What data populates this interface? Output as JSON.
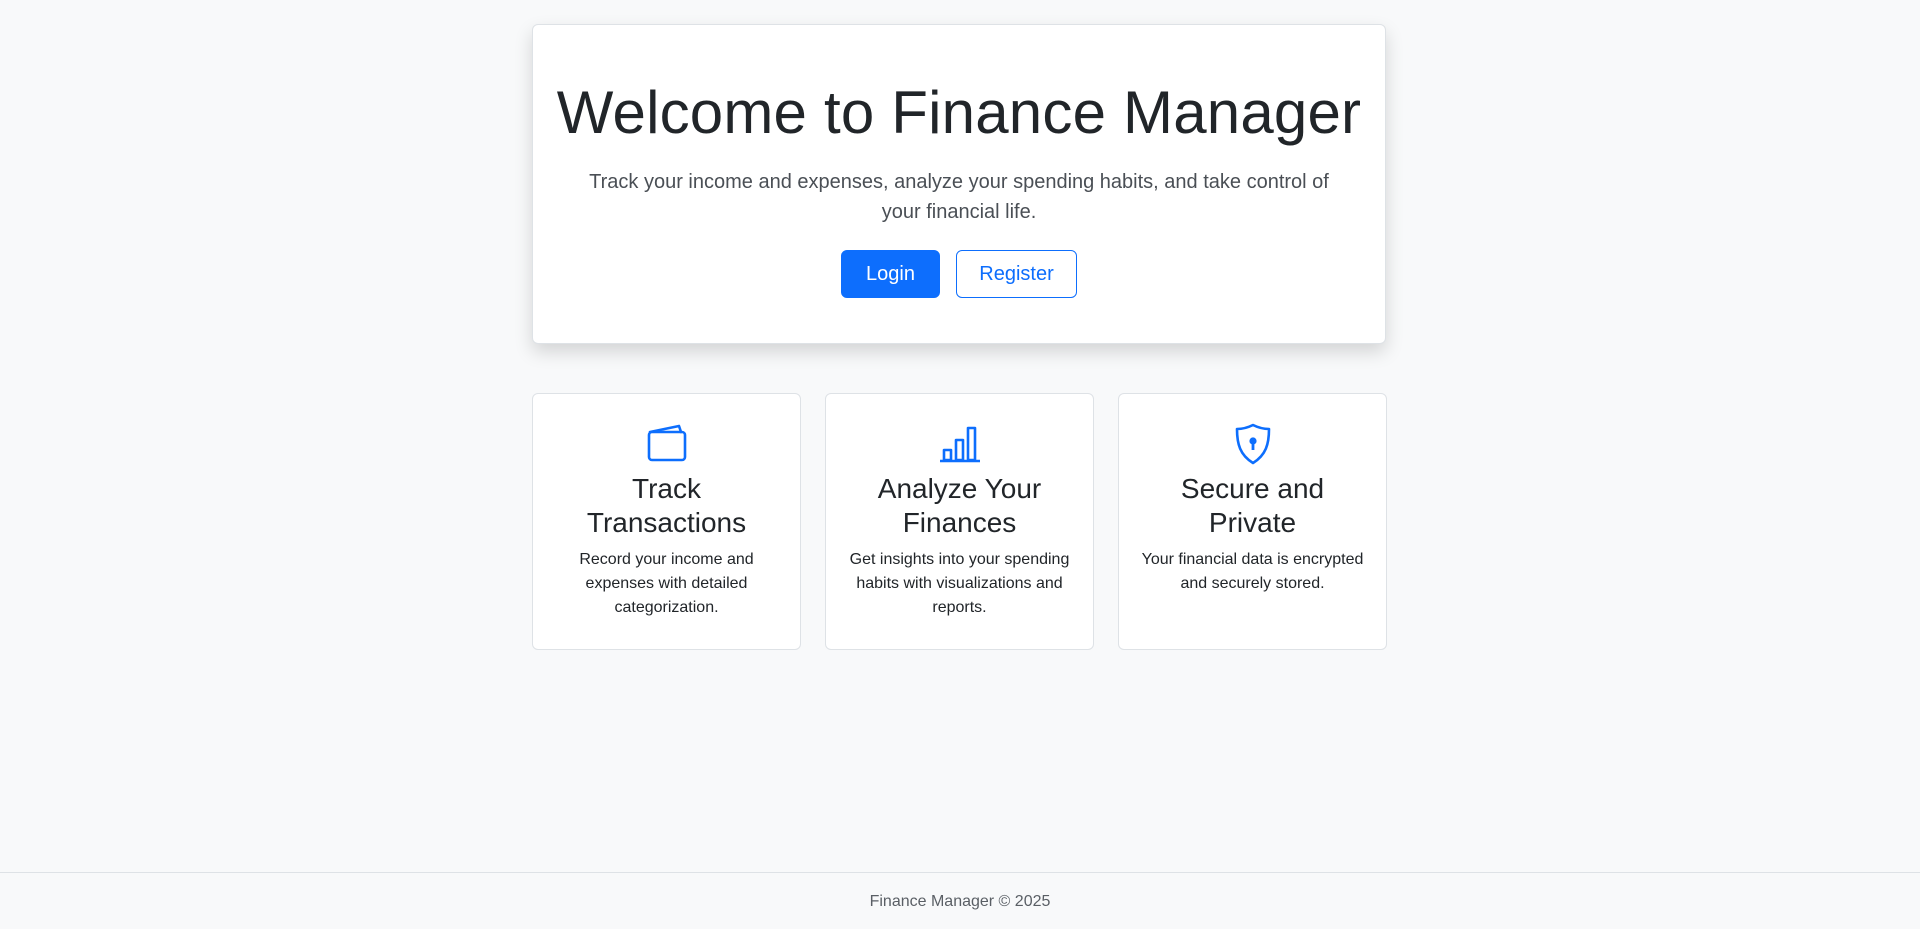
{
  "hero": {
    "title": "Welcome to Finance Manager",
    "lead": "Track your income and expenses, analyze your spending habits, and take control of your financial life.",
    "login_label": "Login",
    "register_label": "Register"
  },
  "features": [
    {
      "icon": "wallet-icon",
      "title": "Track Transactions",
      "description": "Record your income and expenses with detailed categorization."
    },
    {
      "icon": "bar-chart-icon",
      "title": "Analyze Your Finances",
      "description": "Get insights into your spending habits with visualizations and reports."
    },
    {
      "icon": "shield-lock-icon",
      "title": "Secure and Private",
      "description": "Your financial data is encrypted and securely stored."
    }
  ],
  "footer": {
    "text": "Finance Manager © 2025"
  },
  "colors": {
    "accent": "#0d6efd",
    "background": "#f8f9fa",
    "text": "#212529"
  }
}
